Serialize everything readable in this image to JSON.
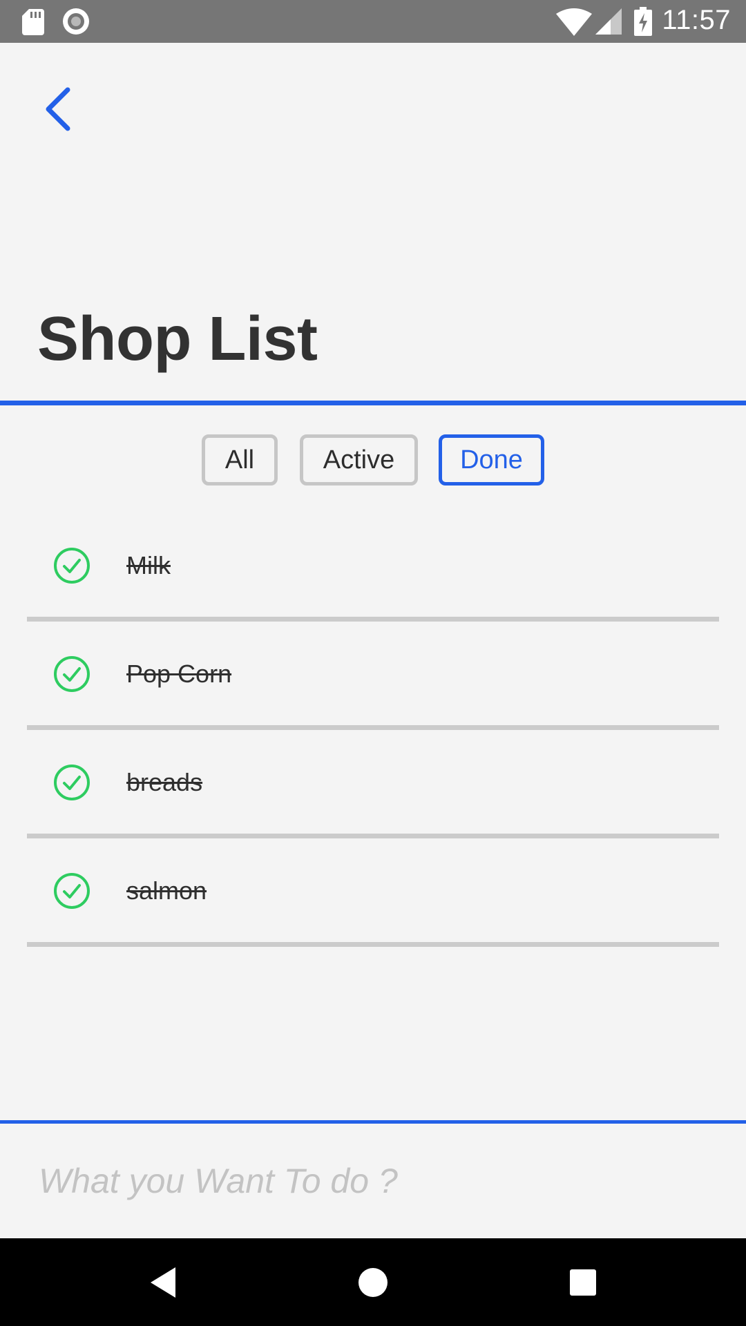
{
  "status_bar": {
    "time": "11:57",
    "icons": [
      "sd-card-icon",
      "record-icon",
      "wifi-icon",
      "signal-icon",
      "battery-charging-icon"
    ]
  },
  "header": {
    "back_icon": "chevron-left-icon",
    "title": "Shop List"
  },
  "filters": {
    "all_label": "All",
    "active_label": "Active",
    "done_label": "Done",
    "selected": "Done"
  },
  "items": [
    {
      "label": "Milk",
      "done": true
    },
    {
      "label": "Pop Corn",
      "done": true
    },
    {
      "label": "breads",
      "done": true
    },
    {
      "label": "salmon",
      "done": true
    }
  ],
  "input": {
    "value": "",
    "placeholder": "What you Want To do ?"
  },
  "colors": {
    "accent": "#2360e8",
    "check": "#2ecc60",
    "status_bar": "#767676",
    "background": "#f4f4f4"
  },
  "nav_bar": {
    "icons": [
      "nav-back-icon",
      "nav-home-icon",
      "nav-recents-icon"
    ]
  }
}
